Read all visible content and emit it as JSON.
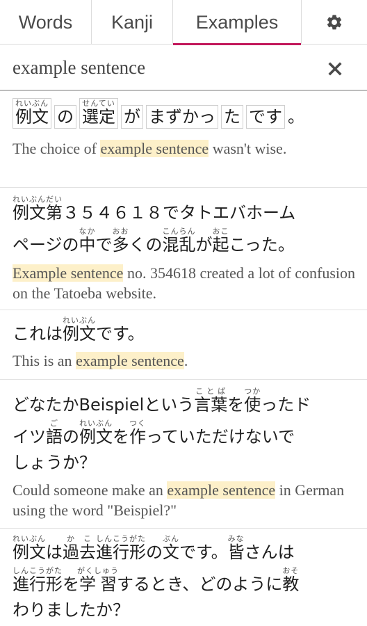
{
  "tabs": [
    {
      "label": "Words"
    },
    {
      "label": "Kanji"
    },
    {
      "label": "Examples"
    }
  ],
  "active_tab": "Examples",
  "search": {
    "value": "example sentence"
  },
  "colors": {
    "accent": "#c2185b",
    "highlight": "#fdf0c9"
  },
  "icons": {
    "settings": "gear-icon",
    "clear": "close-icon"
  },
  "results": [
    {
      "jp": {
        "t1_base": "例文",
        "t1_rt": "れいぶん",
        "t2": "の",
        "t3_base": "選定",
        "t3_rt": "せんてい",
        "t4": "が",
        "t5": "まずかっ",
        "t6": "た",
        "t7": "です",
        "t8": "。"
      },
      "en": {
        "pre": "The choice of ",
        "hl": "example sentence",
        "post": " wasn't wise."
      }
    },
    {
      "jp": {
        "l1_ruby_base": "例文第",
        "l1_ruby_rt": "れいぶんだい",
        "l1_rest": "３５４６１８でタトエバホーム",
        "l2_a": "ページの",
        "l2_b_base": "中",
        "l2_b_rt": "なか",
        "l2_c": "で",
        "l2_d_base": "多",
        "l2_d_rt": "おお",
        "l2_e": "くの",
        "l2_f_base": "混乱",
        "l2_f_rt": "こんらん",
        "l2_g": "が",
        "l2_h_base": "起",
        "l2_h_rt": "おこ",
        "l2_i": "こった。"
      },
      "en": {
        "pre": "",
        "hl": "Example sentence",
        "post": " no. 354618 created a lot of confusion on the Tatoeba website."
      }
    },
    {
      "jp": {
        "a": "これは",
        "b_base": "例文",
        "b_rt": "れいぶん",
        "c": "です。"
      },
      "en": {
        "pre": "This is an ",
        "hl": "example sentence",
        "post": "."
      }
    },
    {
      "jp": {
        "l1_a": "どなたかBeispielという",
        "l1_b_base": "言葉",
        "l1_b_rt": "ことば",
        "l1_c": "を",
        "l1_d_base": "使",
        "l1_d_rt": "つか",
        "l1_e": "ったド",
        "l2_a": "イツ",
        "l2_b_base": "語",
        "l2_b_rt": "ご",
        "l2_c": "の",
        "l2_d_base": "例文",
        "l2_d_rt": "れいぶん",
        "l2_e": "を",
        "l2_f_base": "作",
        "l2_f_rt": "つく",
        "l2_g": "っていただけないで",
        "l3": "しょうか？"
      },
      "en": {
        "pre": "Could someone make an ",
        "hl": "example sentence",
        "post": " in German using the word \"Beispiel?\""
      }
    },
    {
      "jp": {
        "l1_a_base": "例文",
        "l1_a_rt": "れいぶん",
        "l1_b": "は",
        "l1_c_base": "過去",
        "l1_c_rt": "かこ",
        "l1_d_base": "進行形",
        "l1_d_rt": "しんこうがた",
        "l1_e": "の",
        "l1_f_base": "文",
        "l1_f_rt": "ぶん",
        "l1_g": "です。",
        "l1_h_base": "皆",
        "l1_h_rt": "みな",
        "l1_i": "さんは",
        "l2_a_base": "進行形",
        "l2_a_rt": "しんこうがた",
        "l2_b": "を",
        "l2_c_base": "学習",
        "l2_c_rt": "がくしゅう",
        "l2_d": "するとき、どのように",
        "l2_e_base": "教",
        "l2_e_rt": "おそ",
        "l3": "わりましたか？"
      }
    }
  ]
}
